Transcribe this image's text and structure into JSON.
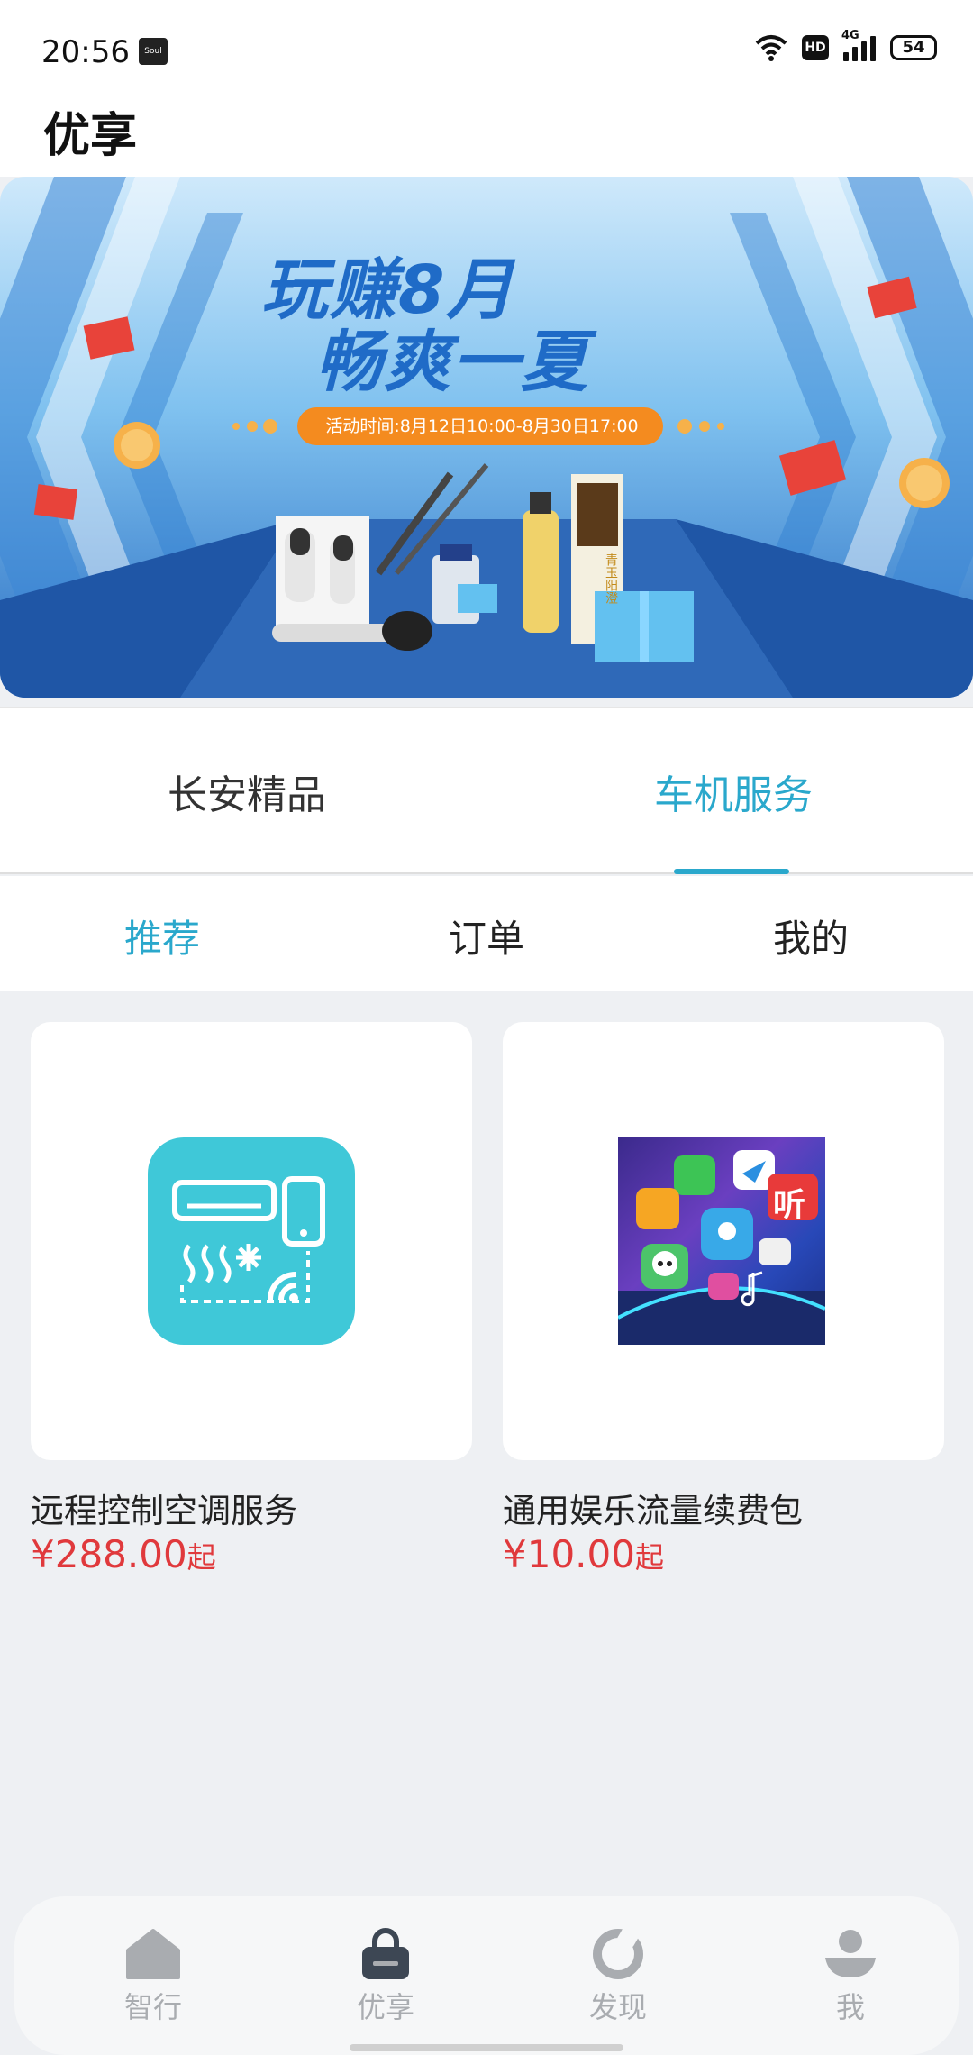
{
  "status_bar": {
    "time": "20:56",
    "app_icon_label": "Soul",
    "network": "4G",
    "hd": "HD",
    "battery": "54"
  },
  "header": {
    "title": "优享"
  },
  "banner": {
    "headline_line1": "玩赚8月",
    "headline_line2": "畅爽一夏",
    "activity_time": "活动时间:8月12日10:00-8月30日17:00",
    "bottle_label": "青玉阳澄"
  },
  "top_tabs": [
    {
      "label": "长安精品",
      "active": false
    },
    {
      "label": "车机服务",
      "active": true
    }
  ],
  "sub_tabs": [
    {
      "label": "推荐",
      "active": true
    },
    {
      "label": "订单",
      "active": false
    },
    {
      "label": "我的",
      "active": false
    }
  ],
  "products": [
    {
      "name": "远程控制空调服务",
      "price": "¥288.00",
      "suffix": "起",
      "icon": "remote-ac-icon"
    },
    {
      "name": "通用娱乐流量续费包",
      "price": "¥10.00",
      "suffix": "起",
      "icon": "entertainment-apps-icon",
      "icon_text": "听"
    }
  ],
  "bottom_nav": [
    {
      "label": "智行",
      "icon": "home-icon"
    },
    {
      "label": "优享",
      "icon": "shopping-bag-icon",
      "active": true
    },
    {
      "label": "发现",
      "icon": "discover-icon"
    },
    {
      "label": "我",
      "icon": "user-icon"
    }
  ],
  "colors": {
    "accent": "#2aa8cc",
    "price": "#e0393c",
    "background": "#eef0f3"
  }
}
